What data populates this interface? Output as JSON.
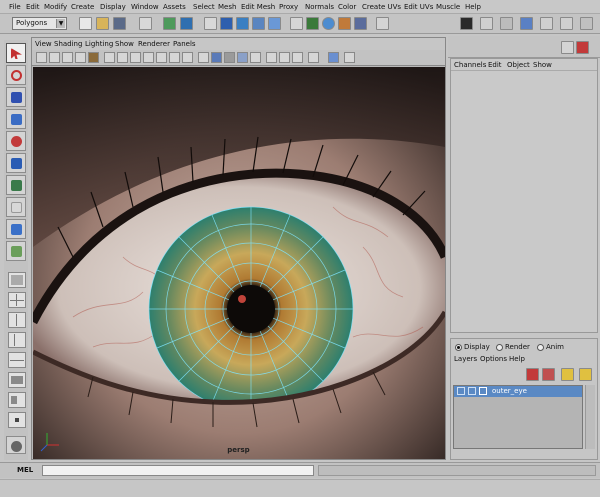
{
  "menubar": {
    "items": [
      "File",
      "Edit",
      "Modify",
      "Create",
      "Display",
      "Window",
      "Assets",
      "Select",
      "Mesh",
      "Edit Mesh",
      "Proxy",
      "Normals",
      "Color",
      "Create UVs",
      "Edit UVs",
      "Muscle",
      "Help"
    ]
  },
  "statusline": {
    "mode_value": "Polygons"
  },
  "panel": {
    "menu": [
      "View",
      "Shading",
      "Lighting",
      "Show",
      "Renderer",
      "Panels"
    ],
    "camera_label": "persp"
  },
  "channel_box": {
    "menu": [
      "Channels",
      "Edit",
      "Object",
      "Show"
    ]
  },
  "layer_editor": {
    "tabs": [
      "Display",
      "Render",
      "Anim"
    ],
    "selected_tab": "Display",
    "menu": [
      "Layers",
      "Options",
      "Help"
    ],
    "layers": [
      {
        "name": "outer_eye"
      }
    ]
  },
  "command_line": {
    "label": "MEL"
  },
  "colors": {
    "layer_highlight": "#5a89c4",
    "wireframe": "#7fe6ff",
    "iris_outer": "#2d7f6e",
    "iris_inner": "#c8a85a"
  }
}
